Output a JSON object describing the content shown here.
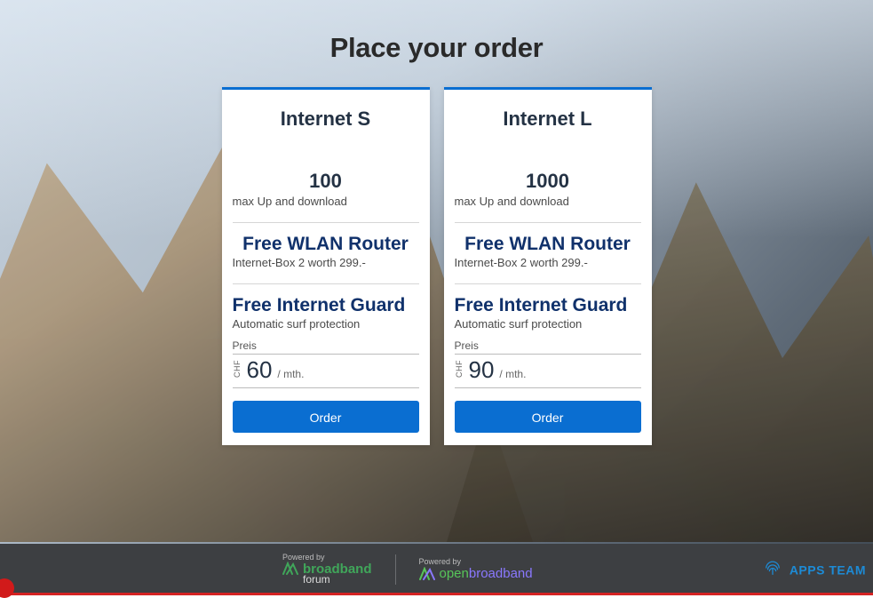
{
  "page": {
    "title": "Place your order"
  },
  "plans": [
    {
      "name": "Internet S",
      "speed_value": "100",
      "speed_caption": "max Up and download",
      "router_title": "Free WLAN Router",
      "router_caption": "Internet-Box 2 worth 299.-",
      "guard_title": "Free Internet Guard",
      "guard_caption": "Automatic surf protection",
      "price_label": "Preis",
      "currency": "CHF",
      "price": "60",
      "period": "/ mth.",
      "order_label": "Order"
    },
    {
      "name": "Internet L",
      "speed_value": "1000",
      "speed_caption": "max Up and download",
      "router_title": "Free WLAN Router",
      "router_caption": "Internet-Box 2 worth 299.-",
      "guard_title": "Free Internet Guard",
      "guard_caption": "Automatic surf protection",
      "price_label": "Preis",
      "currency": "CHF",
      "price": "90",
      "period": "/ mth.",
      "order_label": "Order"
    }
  ],
  "footer": {
    "powered_by": "Powered by",
    "broadband_word": "broadband",
    "broadband_sub": "forum",
    "open_word": "open",
    "openbb_word": "broadband",
    "apps_team": "APPS TEAM"
  }
}
